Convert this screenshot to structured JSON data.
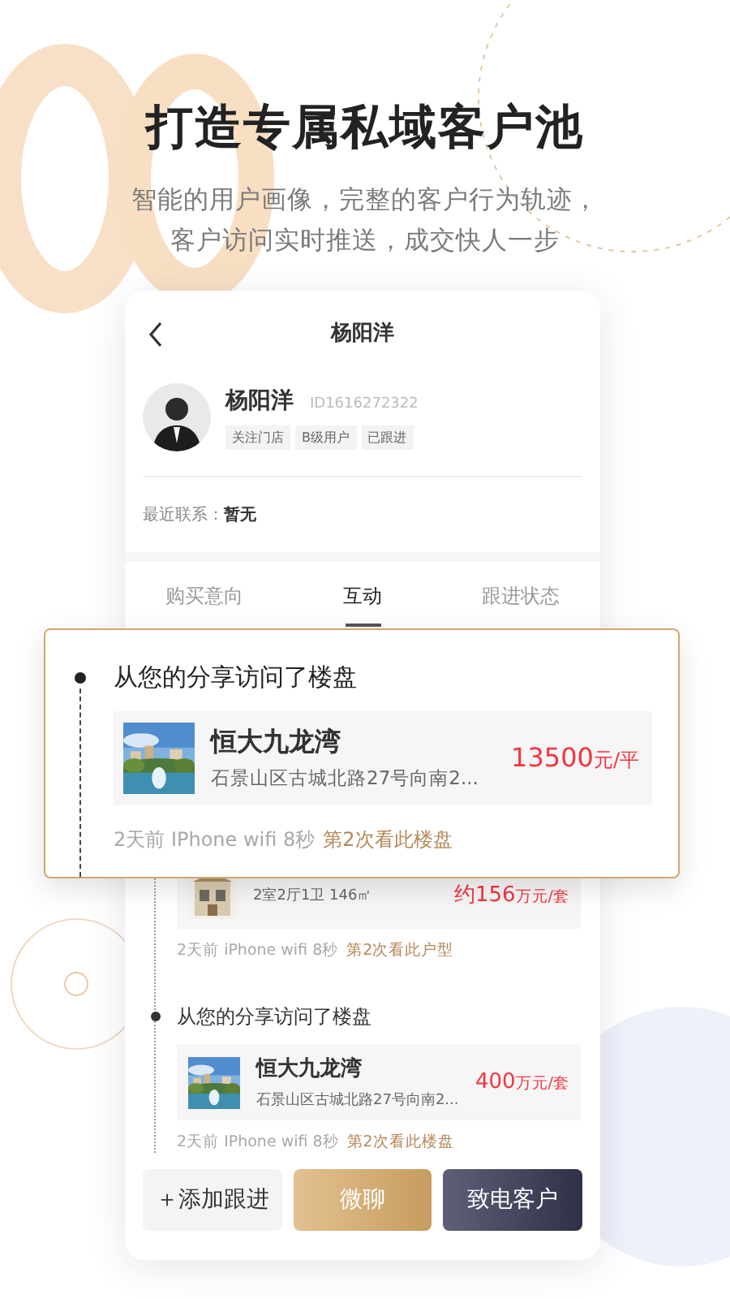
{
  "headline": "打造专属私域客户池",
  "subtitle": [
    "智能的用户画像，完整的客户行为轨迹，",
    "客户访问实时推送，成交快人一步"
  ],
  "phone": {
    "nav_title": "杨阳洋",
    "customer": {
      "name": "杨阳洋",
      "id": "ID1616272322",
      "tags": [
        "关注门店",
        "B级用户",
        "已跟进"
      ]
    },
    "last_contact": {
      "label": "最近联系：",
      "value": "暂无"
    },
    "tabs": [
      {
        "label": "购买意向",
        "selected": false
      },
      {
        "label": "互动",
        "selected": true
      },
      {
        "label": "跟进状态",
        "selected": false
      }
    ],
    "timeline": [
      {
        "kind": "floorplan",
        "detail": "2室2厅1卫 146㎡",
        "price": "约156",
        "unit": "万元/套",
        "meta": "2天前 iPhone wifi 8秒",
        "note": "第2次看此户型"
      },
      {
        "kind": "estate",
        "title": "从您的分享访问了楼盘",
        "name": "恒大九龙湾",
        "detail": "石景山区古城北路27号向南2...",
        "price": "400",
        "unit": "万元/套",
        "meta": "2天前 IPhone wifi 8秒",
        "note": "第2次看此楼盘"
      }
    ],
    "actions": [
      {
        "label": "＋添加跟进",
        "kind": "plain"
      },
      {
        "label": "微聊",
        "kind": "gold"
      },
      {
        "label": "致电客户",
        "kind": "dark"
      }
    ]
  },
  "popup": {
    "title": "从您的分享访问了楼盘",
    "name": "恒大九龙湾",
    "detail": "石景山区古城北路27号向南2...",
    "price": "13500",
    "unit": "元/平",
    "meta": "2天前 IPhone wifi 8秒",
    "note": "第2次看此楼盘"
  }
}
